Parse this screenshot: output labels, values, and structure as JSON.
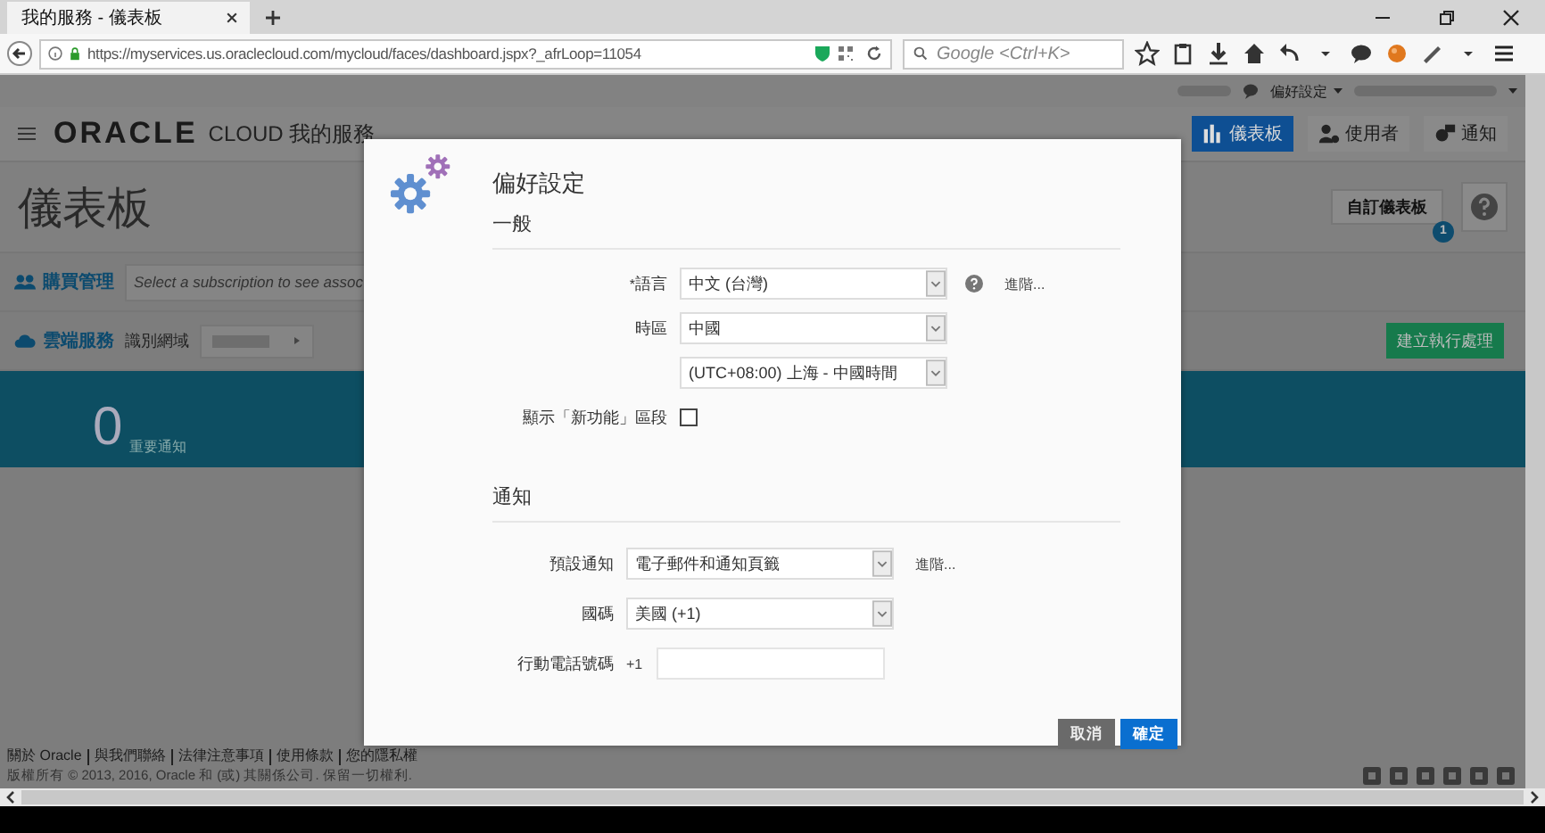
{
  "browser": {
    "tab_title": "我的服務 - 儀表板",
    "url": "https://myservices.us.oraclecloud.com/mycloud/faces/dashboard.jspx?_afrLoop=11054",
    "search_placeholder": "Google <Ctrl+K>"
  },
  "page": {
    "user_menu": "偏好設定",
    "brand": {
      "logo": "ORACLE",
      "product": "CLOUD 我的服務"
    },
    "nav_buttons": [
      {
        "label": "儀表板",
        "selected": true
      },
      {
        "label": "使用者",
        "selected": false
      },
      {
        "label": "通知",
        "selected": false
      }
    ],
    "title": "儀表板",
    "customize_button": "自訂儀表板",
    "customize_badge": "1",
    "purchase": {
      "label": "購買管理",
      "placeholder": "Select a subscription to see assoc"
    },
    "cloud": {
      "label": "雲端服務",
      "domain_label": "識別網域"
    },
    "create_button": "建立執行處理",
    "notifications": {
      "count": "0",
      "label": "重要通知"
    },
    "footer": {
      "links": [
        "關於 Oracle",
        "與我們聯絡",
        "法律注意事項",
        "使用條款",
        "您的隱私權"
      ],
      "copyright": "版權所有 © 2013, 2016, Oracle 和 (或) 其關係公司. 保留一切權利."
    }
  },
  "dialog": {
    "title": "偏好設定",
    "sections": [
      {
        "heading": "一般",
        "rows": [
          {
            "kind": "select",
            "mark": "*",
            "label": "語言",
            "value": "中文 (台灣)",
            "help": true,
            "link": "進階..."
          },
          {
            "kind": "select",
            "label": "時區",
            "value": "中國"
          },
          {
            "kind": "select",
            "value": "(UTC+08:00) 上海 - 中國時間"
          },
          {
            "kind": "checkbox",
            "label": "顯示「新功能」區段",
            "checked": false
          }
        ]
      },
      {
        "heading": "通知",
        "rows": [
          {
            "kind": "select",
            "label": "預設通知",
            "value": "電子郵件和通知頁籤",
            "link": "進階..."
          },
          {
            "kind": "select",
            "label": "國碼",
            "value": "美國 (+1)"
          },
          {
            "kind": "phone",
            "label": "行動電話號碼",
            "prefix": "+1"
          }
        ]
      }
    ],
    "buttons": [
      {
        "label": "取消",
        "kind": "secondary"
      },
      {
        "label": "確定",
        "kind": "primary"
      }
    ]
  }
}
